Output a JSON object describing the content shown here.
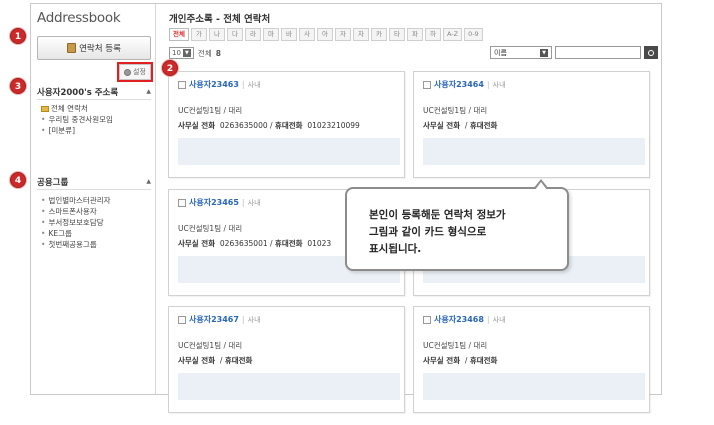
{
  "sidebar": {
    "app_title": "Addressbook",
    "add_contact_label": "연락처 등록",
    "settings_label": "설정",
    "group_section": {
      "title": "사용자2000's 주소록",
      "items": [
        "전체 연락처",
        "우리팀 중견사원모임",
        "[미분류]"
      ]
    },
    "public_section": {
      "title": "공용그룹",
      "items": [
        "법인별마스터관리자",
        "스마트폰사용자",
        "부서정보보호담당",
        "KE그룹",
        "첫번째공용그룹"
      ]
    }
  },
  "main": {
    "title": "개인주소록 - 전체 연락처",
    "alpha_tabs": [
      "전체",
      "가",
      "나",
      "다",
      "라",
      "마",
      "바",
      "사",
      "아",
      "자",
      "차",
      "카",
      "타",
      "파",
      "하",
      "A-Z",
      "0-9"
    ],
    "page_size": "10",
    "total_label": "전체",
    "total_count": "8",
    "search_field": "이름",
    "cards": [
      {
        "name": "사용자23463",
        "tag": "사내",
        "dept": "UC컨설팅1팀 / 대리",
        "office_label": "사무실 전화",
        "office": "0263635000",
        "mobile_label": "휴대전화",
        "mobile": "01023210099"
      },
      {
        "name": "사용자23464",
        "tag": "사내",
        "dept": "UC컨설팅1팀 / 대리",
        "office_label": "사무실 전화",
        "office": "",
        "mobile_label": "휴대전화",
        "mobile": ""
      },
      {
        "name": "사용자23465",
        "tag": "사내",
        "dept": "UC컨설팅1팀 / 대리",
        "office_label": "사무실 전화",
        "office": "0263635001",
        "mobile_label": "휴대전화",
        "mobile": "01023"
      },
      {
        "name": "",
        "tag": "",
        "dept": "",
        "office_label": "",
        "office": "",
        "mobile_label": "",
        "mobile": ""
      },
      {
        "name": "사용자23467",
        "tag": "사내",
        "dept": "UC컨설팅1팀 / 대리",
        "office_label": "사무실 전화",
        "office": "",
        "mobile_label": "휴대전화",
        "mobile": ""
      },
      {
        "name": "사용자23468",
        "tag": "사내",
        "dept": "UC컨설팅1팀 / 대리",
        "office_label": "사무실 전화",
        "office": "",
        "mobile_label": "휴대전화",
        "mobile": ""
      }
    ]
  },
  "annotations": {
    "badges": [
      "1",
      "2",
      "3",
      "4"
    ],
    "callout": "본인이 등록해둔 연락처 정보가\n그림과 같이 카드 형식으로\n표시됩니다."
  },
  "colors": {
    "accent_red": "#cc2a2a",
    "link_blue": "#2a66b8"
  }
}
